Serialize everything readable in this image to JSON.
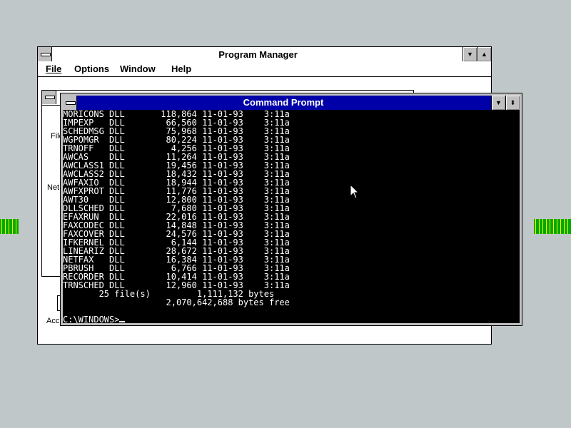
{
  "desktop": {
    "background": "#c0c7c8"
  },
  "program_manager": {
    "title": "Program Manager",
    "menu": [
      {
        "label": "File"
      },
      {
        "label": "Options"
      },
      {
        "label": "Window"
      },
      {
        "label": "Help"
      }
    ],
    "group_window": {
      "labels": [
        "File",
        "Net",
        "Acc"
      ]
    }
  },
  "command_prompt": {
    "title": "Command Prompt",
    "files": [
      {
        "name": "MORICONS",
        "ext": "DLL",
        "size": "118,864",
        "date": "11-01-93",
        "time": "3:11a"
      },
      {
        "name": "IMPEXP",
        "ext": "DLL",
        "size": "66,560",
        "date": "11-01-93",
        "time": "3:11a"
      },
      {
        "name": "SCHEDMSG",
        "ext": "DLL",
        "size": "75,968",
        "date": "11-01-93",
        "time": "3:11a"
      },
      {
        "name": "WGPOMGR",
        "ext": "DLL",
        "size": "80,224",
        "date": "11-01-93",
        "time": "3:11a"
      },
      {
        "name": "TRNOFF",
        "ext": "DLL",
        "size": "4,256",
        "date": "11-01-93",
        "time": "3:11a"
      },
      {
        "name": "AWCAS",
        "ext": "DLL",
        "size": "11,264",
        "date": "11-01-93",
        "time": "3:11a"
      },
      {
        "name": "AWCLASS1",
        "ext": "DLL",
        "size": "19,456",
        "date": "11-01-93",
        "time": "3:11a"
      },
      {
        "name": "AWCLASS2",
        "ext": "DLL",
        "size": "18,432",
        "date": "11-01-93",
        "time": "3:11a"
      },
      {
        "name": "AWFAXIO",
        "ext": "DLL",
        "size": "18,944",
        "date": "11-01-93",
        "time": "3:11a"
      },
      {
        "name": "AWFXPROT",
        "ext": "DLL",
        "size": "11,776",
        "date": "11-01-93",
        "time": "3:11a"
      },
      {
        "name": "AWT30",
        "ext": "DLL",
        "size": "12,800",
        "date": "11-01-93",
        "time": "3:11a"
      },
      {
        "name": "DLLSCHED",
        "ext": "DLL",
        "size": "7,680",
        "date": "11-01-93",
        "time": "3:11a"
      },
      {
        "name": "EFAXRUN",
        "ext": "DLL",
        "size": "22,016",
        "date": "11-01-93",
        "time": "3:11a"
      },
      {
        "name": "FAXCODEC",
        "ext": "DLL",
        "size": "14,848",
        "date": "11-01-93",
        "time": "3:11a"
      },
      {
        "name": "FAXCOVER",
        "ext": "DLL",
        "size": "24,576",
        "date": "11-01-93",
        "time": "3:11a"
      },
      {
        "name": "IFKERNEL",
        "ext": "DLL",
        "size": "6,144",
        "date": "11-01-93",
        "time": "3:11a"
      },
      {
        "name": "LINEARIZ",
        "ext": "DLL",
        "size": "28,672",
        "date": "11-01-93",
        "time": "3:11a"
      },
      {
        "name": "NETFAX",
        "ext": "DLL",
        "size": "16,384",
        "date": "11-01-93",
        "time": "3:11a"
      },
      {
        "name": "PBRUSH",
        "ext": "DLL",
        "size": "6,766",
        "date": "11-01-93",
        "time": "3:11a"
      },
      {
        "name": "RECORDER",
        "ext": "DLL",
        "size": "10,414",
        "date": "11-01-93",
        "time": "3:11a"
      },
      {
        "name": "TRNSCHED",
        "ext": "DLL",
        "size": "12,960",
        "date": "11-01-93",
        "time": "3:11a"
      }
    ],
    "summary_files": "25 file(s)",
    "summary_bytes": "1,111,132 bytes",
    "summary_free": "2,070,642,688 bytes free",
    "prompt": "C:\\WINDOWS>"
  }
}
